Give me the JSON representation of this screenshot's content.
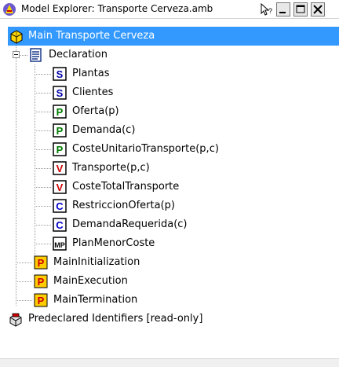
{
  "window": {
    "title": "Model Explorer: Transporte Cerveza.amb"
  },
  "tree": {
    "root": {
      "label": "Main Transporte Cerveza"
    },
    "declaration": {
      "label": "Declaration",
      "children": [
        {
          "label": "Plantas",
          "type": "S"
        },
        {
          "label": "Clientes",
          "type": "S"
        },
        {
          "label": "Oferta(p)",
          "type": "P"
        },
        {
          "label": "Demanda(c)",
          "type": "P"
        },
        {
          "label": "CosteUnitarioTransporte(p,c)",
          "type": "P"
        },
        {
          "label": "Transporte(p,c)",
          "type": "V"
        },
        {
          "label": "CosteTotalTransporte",
          "type": "V"
        },
        {
          "label": "RestriccionOferta(p)",
          "type": "C"
        },
        {
          "label": "DemandaRequerida(c)",
          "type": "C"
        },
        {
          "label": "PlanMenorCoste",
          "type": "MP"
        }
      ]
    },
    "procedures": [
      {
        "label": "MainInitialization"
      },
      {
        "label": "MainExecution"
      },
      {
        "label": "MainTermination"
      }
    ],
    "predeclared": {
      "label": "Predeclared Identifiers [read-only]"
    }
  },
  "icon_letters": {
    "S": "S",
    "P": "P",
    "V": "V",
    "C": "C",
    "MP": "MP",
    "proc": "P"
  },
  "colors": {
    "selection": "#3399ff",
    "set": "#0000aa",
    "parameter": "#007a00",
    "variable": "#cc0000",
    "constraint": "#0000cc",
    "procedure": "#cc0000",
    "procedure_bg": "#ffcc00"
  }
}
